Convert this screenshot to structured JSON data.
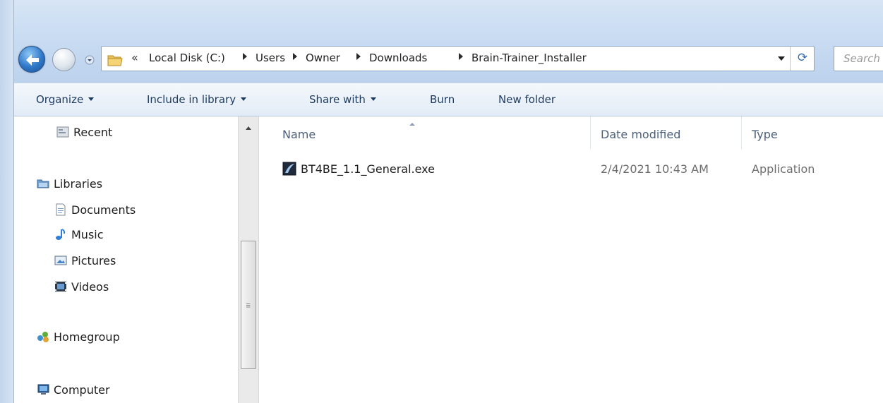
{
  "address": {
    "overflow": "«",
    "crumbs": [
      "Local Disk (C:)",
      "Users",
      "Owner",
      "Downloads",
      "Brain-Trainer_Installer"
    ],
    "refresh_glyph": "⟳"
  },
  "search": {
    "placeholder": "Search"
  },
  "toolbar": {
    "organize": "Organize",
    "include_in_library": "Include in library",
    "share_with": "Share with",
    "burn": "Burn",
    "new_folder": "New folder"
  },
  "nav": {
    "recent": "Recent",
    "libraries": "Libraries",
    "documents": "Documents",
    "music": "Music",
    "pictures": "Pictures",
    "videos": "Videos",
    "homegroup": "Homegroup",
    "computer": "Computer"
  },
  "columns": {
    "name": "Name",
    "date_modified": "Date modified",
    "type": "Type"
  },
  "files": [
    {
      "name": "BT4BE_1.1_General.exe",
      "date_modified": "2/4/2021 10:43 AM",
      "type": "Application",
      "icon": "application-exe-icon"
    }
  ],
  "colors": {
    "titlebar": "#c9dcf2",
    "toolbar": "#e2ebf6",
    "column_header_text": "#4a5f7a"
  }
}
